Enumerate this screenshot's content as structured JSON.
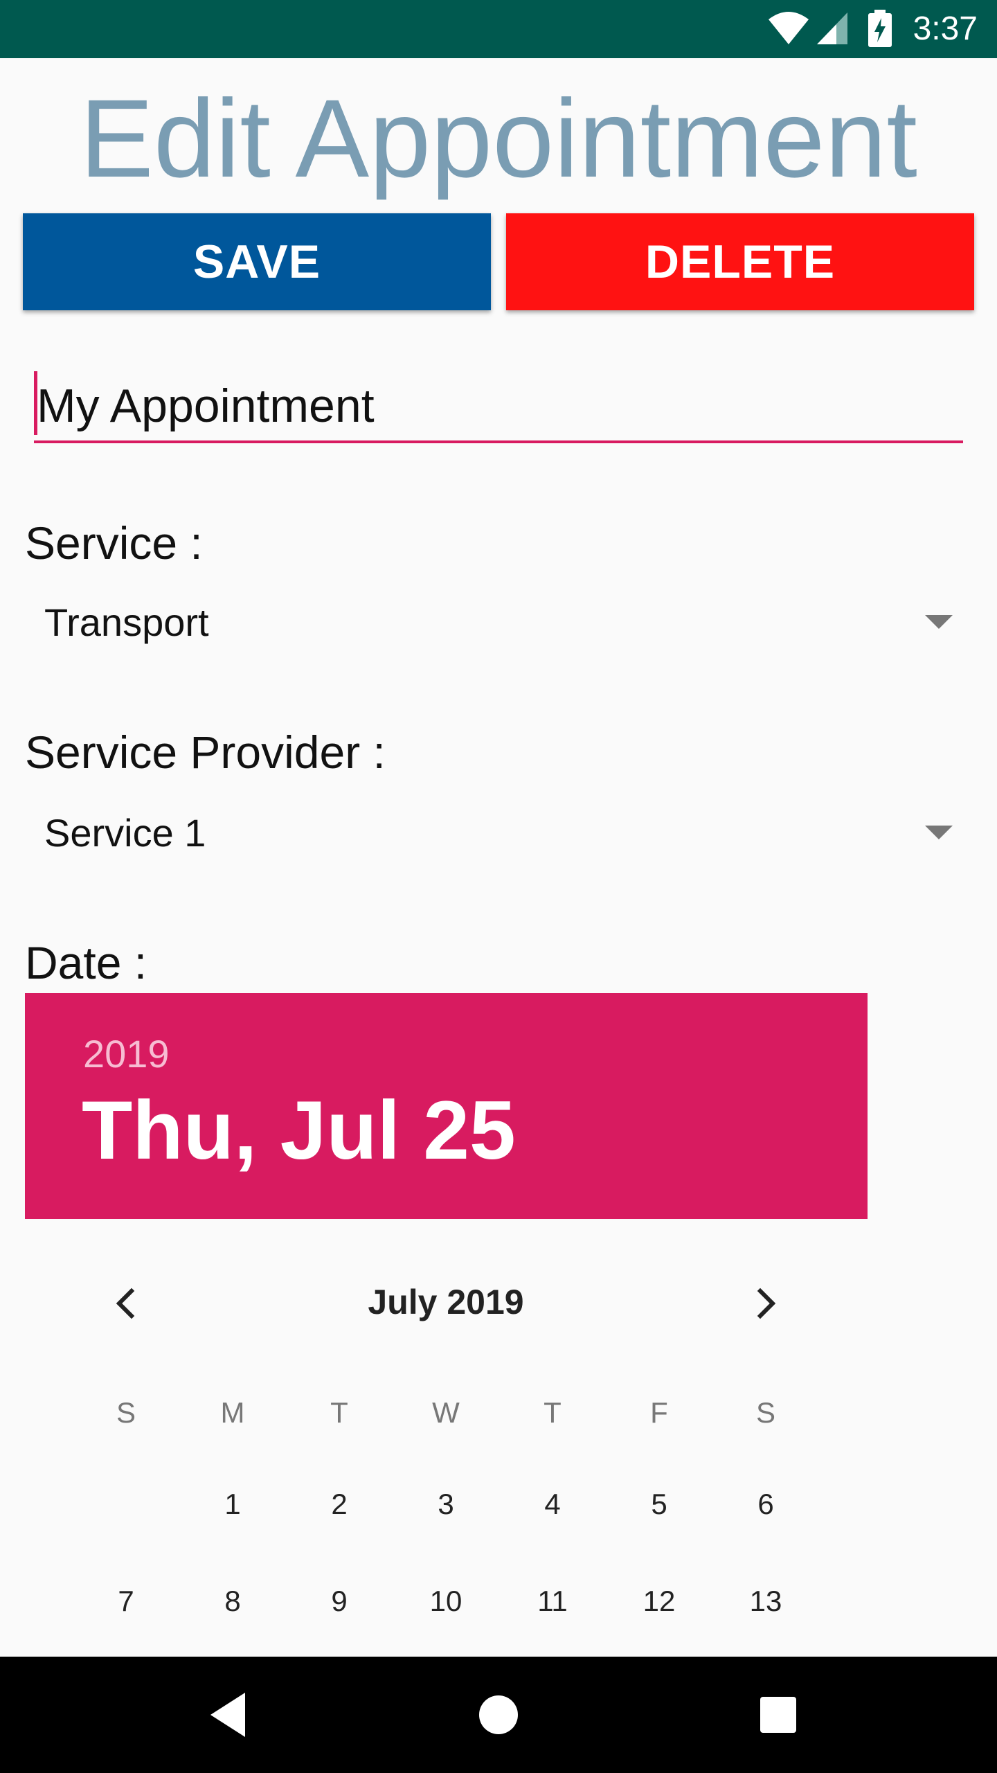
{
  "status_bar": {
    "time": "3:37",
    "background": "#00594f",
    "icons": [
      "wifi-icon",
      "cellular-signal-icon",
      "battery-charging-icon"
    ]
  },
  "page": {
    "title": "Edit Appointment",
    "title_color": "#7a9db3"
  },
  "actions": {
    "save_label": "SAVE",
    "save_color": "#00579b",
    "delete_label": "DELETE",
    "delete_color": "#ff1212"
  },
  "form": {
    "name_value": "My Appointment",
    "accent_color": "#d81b60",
    "service_label": "Service :",
    "service_value": "Transport",
    "provider_label": "Service Provider :",
    "provider_value": "Service 1",
    "date_label": "Date :"
  },
  "date_picker": {
    "year": "2019",
    "selected_date": "Thu, Jul 25",
    "month_title": "July 2019",
    "weekdays": [
      "S",
      "M",
      "T",
      "W",
      "T",
      "F",
      "S"
    ],
    "weeks": [
      [
        "",
        "1",
        "2",
        "3",
        "4",
        "5",
        "6"
      ],
      [
        "7",
        "8",
        "9",
        "10",
        "11",
        "12",
        "13"
      ]
    ],
    "prev_icon": "chevron-left-icon",
    "next_icon": "chevron-right-icon"
  },
  "nav_bar": {
    "icons": [
      "back-icon",
      "home-icon",
      "recents-icon"
    ]
  }
}
